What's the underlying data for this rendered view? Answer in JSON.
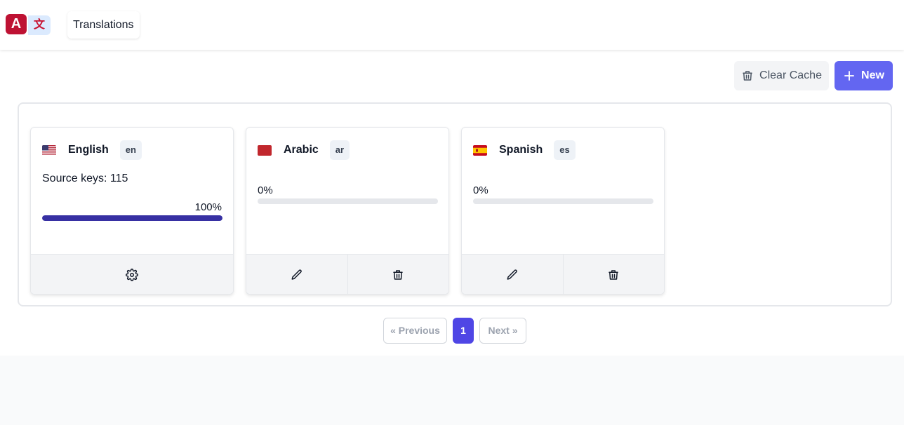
{
  "header": {
    "logo_glyph_a": "A",
    "logo_glyph_b": "文",
    "nav_translations": "Translations"
  },
  "toolbar": {
    "clear_cache_label": "Clear Cache",
    "new_label": "New"
  },
  "cards": [
    {
      "name": "English",
      "code": "en",
      "source_keys": "Source keys: 115",
      "percent_label": "100%",
      "progress": 100,
      "flag": "us-flag-icon"
    },
    {
      "name": "Arabic",
      "code": "ar",
      "percent_label": "0%",
      "progress": 0,
      "flag": "arabic-flag-icon"
    },
    {
      "name": "Spanish",
      "code": "es",
      "percent_label": "0%",
      "progress": 0,
      "flag": "spain-flag-icon"
    }
  ],
  "pagination": {
    "previous": "« Previous",
    "current": "1",
    "next": "Next »"
  },
  "colors": {
    "primary": "#6366f1",
    "progress_fill": "#3730a3",
    "logo_red": "#be1233"
  }
}
